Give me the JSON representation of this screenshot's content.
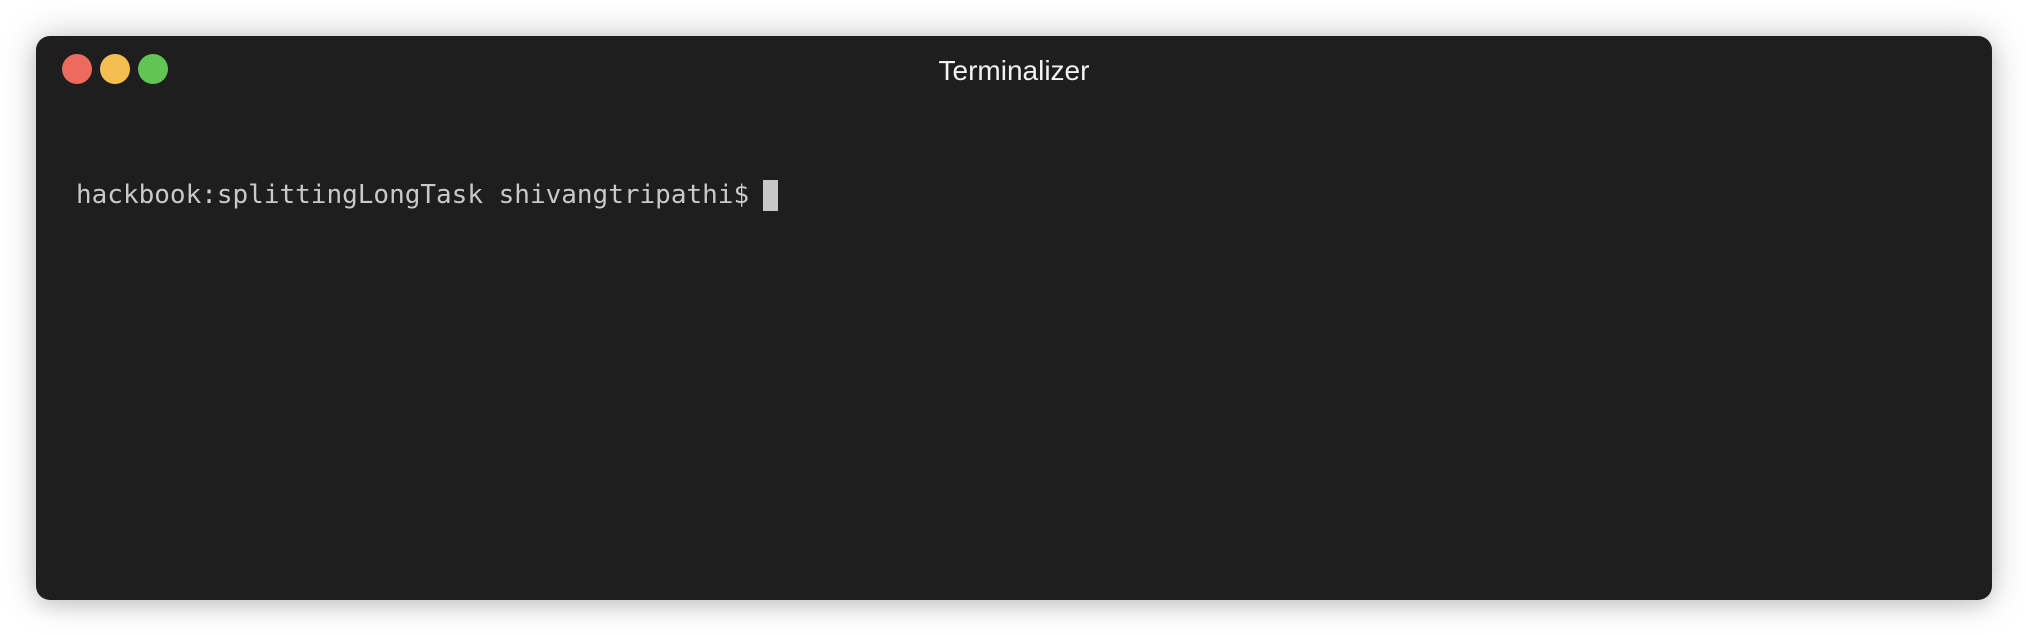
{
  "window": {
    "title": "Terminalizer",
    "colors": {
      "background": "#1e1e1e",
      "close": "#ed6a5e",
      "minimize": "#f5bf4f",
      "zoom": "#61c554",
      "text": "#c9c9c9"
    }
  },
  "terminal": {
    "prompt": "hackbook:splittingLongTask shivangtripathi$",
    "input": "",
    "cursor_icon": "block-cursor-icon"
  }
}
